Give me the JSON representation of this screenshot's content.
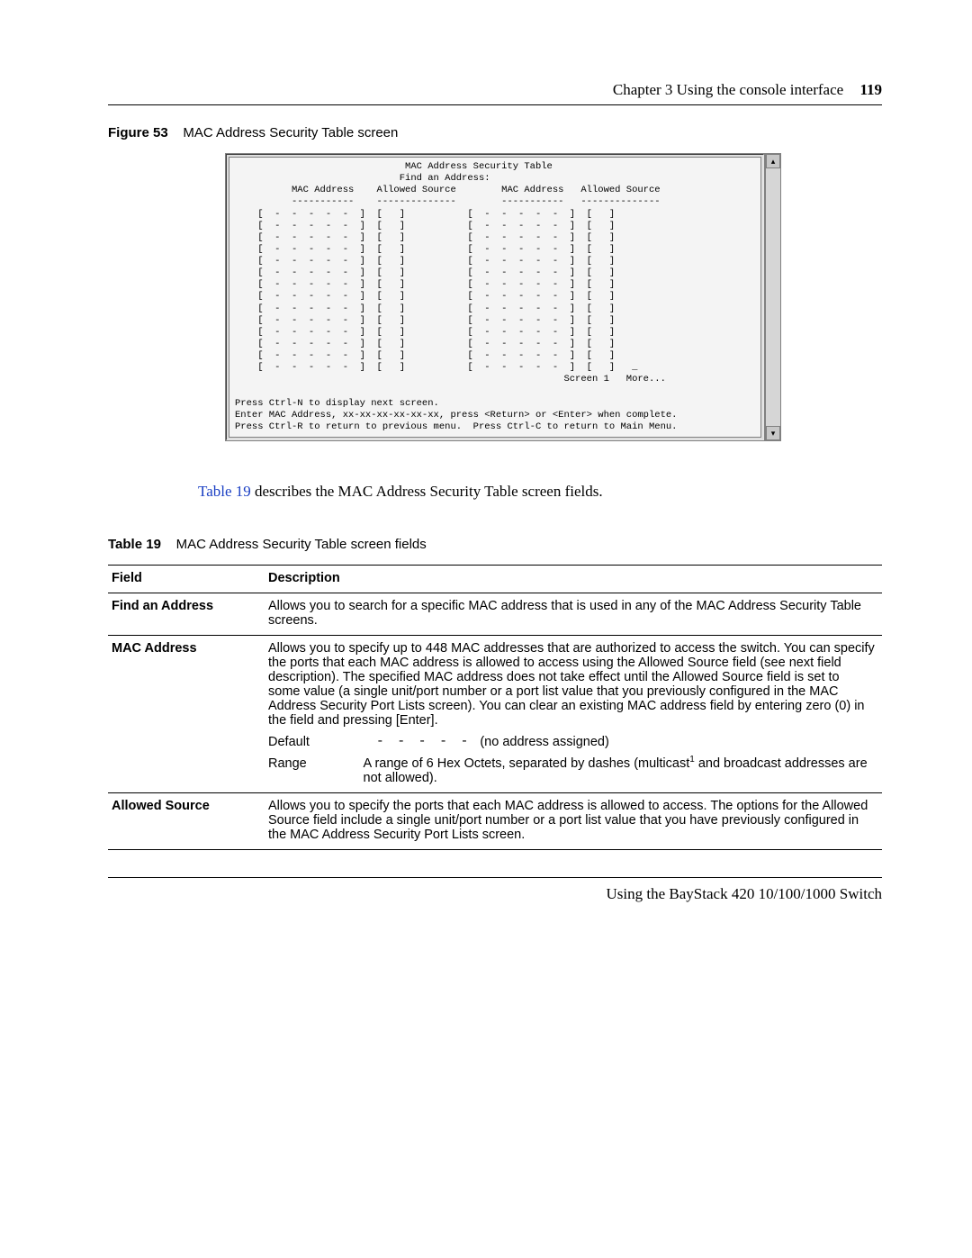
{
  "header": {
    "chapter": "Chapter 3  Using the console interface",
    "page_number": "119"
  },
  "figure": {
    "label": "Figure 53",
    "caption": "MAC Address Security Table screen"
  },
  "terminal": {
    "title": "                              MAC Address Security Table",
    "find_line": "                             Find an Address:",
    "col_head": "          MAC Address    Allowed Source        MAC Address   Allowed Source",
    "col_rule": "          -----------    --------------        -----------   --------------",
    "row": "    [  -  -  -  -  -  ]  [   ]           [  -  -  -  -  -  ]  [   ]",
    "row_last": "    [  -  -  -  -  -  ]  [   ]           [  -  -  -  -  -  ]  [   ]   _",
    "screen_more": "                                                          Screen 1   More...",
    "help1": "Press Ctrl-N to display next screen.",
    "help2": "Enter MAC Address, xx-xx-xx-xx-xx-xx, press <Return> or <Enter> when complete.",
    "help3": "Press Ctrl-R to return to previous menu.  Press Ctrl-C to return to Main Menu.",
    "row_count": 13
  },
  "midtext": {
    "link": "Table 19",
    "rest": " describes the MAC Address Security Table screen fields."
  },
  "table_caption": {
    "label": "Table 19",
    "caption": "MAC Address Security Table screen fields"
  },
  "table": {
    "head_field": "Field",
    "head_desc": "Description",
    "rows": [
      {
        "field": "Find an Address",
        "desc": "Allows you to search for a specific MAC address that is used in any of the MAC Address Security Table screens."
      },
      {
        "field": "MAC Address",
        "desc": "Allows you to specify up to 448 MAC addresses that are authorized to access the switch. You can specify the ports that each MAC address is allowed to access using the Allowed Source field (see next field description). The specified MAC address does not take effect until the Allowed Source field is set to some value (a single unit/port number or a port list value that you previously configured in the MAC Address Security Port Lists screen). You can clear an existing MAC address field by entering zero (0) in the field and pressing [Enter].",
        "default_label": "Default",
        "default_mono": "- - - - -",
        "default_paren": "(no address assigned)",
        "range_label": "Range",
        "range_text1": "A range of 6 Hex Octets, separated by dashes (multicast",
        "range_sup": "1",
        "range_text2": " and broadcast addresses are not allowed)."
      },
      {
        "field": "Allowed Source",
        "desc": "Allows you to specify the ports that each MAC address is allowed to access. The options for the Allowed Source field include a single unit/port number or a port list value that you have previously configured in the MAC Address Security Port Lists screen."
      }
    ]
  },
  "footer": {
    "text": "Using the BayStack 420 10/100/1000 Switch"
  }
}
